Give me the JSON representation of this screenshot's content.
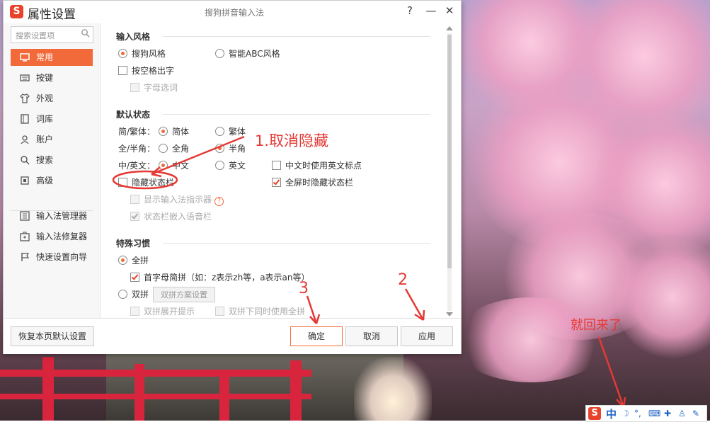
{
  "window": {
    "title": "属性设置",
    "app_name": "搜狗拼音输入法",
    "help_glyph": "?",
    "minimize_glyph": "—",
    "close_glyph": "✕",
    "logo_letter": "S"
  },
  "sidebar": {
    "search_placeholder": "搜索设置项",
    "items": [
      {
        "label": "常用",
        "icon": "monitor-icon",
        "active": true
      },
      {
        "label": "按键",
        "icon": "keyboard-icon"
      },
      {
        "label": "外观",
        "icon": "shirt-icon"
      },
      {
        "label": "词库",
        "icon": "book-icon"
      },
      {
        "label": "账户",
        "icon": "user-icon"
      },
      {
        "label": "搜索",
        "icon": "search-icon"
      },
      {
        "label": "高级",
        "icon": "square-icon"
      }
    ],
    "tools": [
      {
        "label": "输入法管理器",
        "icon": "manager-icon"
      },
      {
        "label": "输入法修复器",
        "icon": "repair-icon"
      },
      {
        "label": "快速设置向导",
        "icon": "flag-icon"
      }
    ]
  },
  "settings": {
    "input_style": {
      "title": "输入风格",
      "sogou": "搜狗风格",
      "abc": "智能ABC风格",
      "space_output": "按空格出字",
      "letter_select": "字母选词"
    },
    "default_state": {
      "title": "默认状态",
      "script_label": "简/繁体：",
      "simplified": "简体",
      "traditional": "繁体",
      "width_label": "全/半角：",
      "full": "全角",
      "half": "半角",
      "lang_label": "中/英文：",
      "chinese": "中文",
      "english": "英文",
      "english_punct": "中文时使用英文标点",
      "hide_statusbar": "隐藏状态栏",
      "fullscreen_hide": "全屏时隐藏状态栏",
      "show_indicator": "显示输入法指示器",
      "embed_voice": "状态栏嵌入语音栏",
      "help_mark": "?"
    },
    "special": {
      "title": "特殊习惯",
      "quanpin": "全拼",
      "initial_abbr": "首字母简拼（如：z表示zh等，a表示an等）",
      "shuangpin": "双拼",
      "shuangpin_scheme": "双拼方案设置",
      "shuangpin_hint": "双拼展开提示",
      "shuangpin_both": "双拼下同时使用全拼"
    }
  },
  "footer": {
    "restore": "恢复本页默认设置",
    "ok": "确定",
    "cancel": "取消",
    "apply": "应用"
  },
  "annotations": {
    "step1": "1.取消隐藏",
    "step2": "2",
    "step3": "3",
    "back": "就回来了",
    "color": "#e53935"
  },
  "imebar": {
    "logo": "S",
    "mode": "中",
    "moon": "☽",
    "punct": "°,",
    "keyboard": "⌨",
    "tool": "✚",
    "shirt": "♙",
    "wrench": "✎"
  },
  "colors": {
    "accent": "#f26a3a",
    "brand": "#e8432b"
  }
}
